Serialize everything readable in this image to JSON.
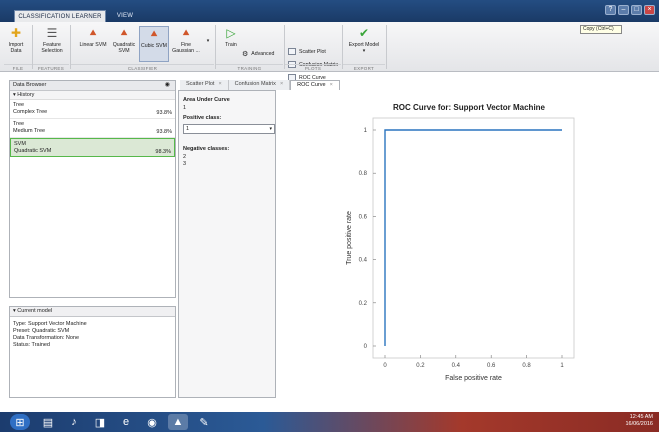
{
  "window": {
    "tabs": [
      "CLASSIFICATION LEARNER",
      "VIEW"
    ],
    "tooltip": "Copy (Ctrl+C)"
  },
  "ribbon": {
    "file": [
      {
        "label": "Import\nData"
      }
    ],
    "features": [
      {
        "label": "Feature\nSelection"
      }
    ],
    "classifier": [
      {
        "label": "Linear SVM"
      },
      {
        "label": "Quadratic\nSVM"
      },
      {
        "label": "Cubic SVM"
      },
      {
        "label": "Fine\nGaussian ..."
      }
    ],
    "training": {
      "train": "Train",
      "advanced": "Advanced"
    },
    "plots": [
      "Scatter Plot",
      "Confusion Matrix",
      "ROC Curve"
    ],
    "export": {
      "label": "Export Model"
    },
    "group_labels": [
      "FILE",
      "FEATURES",
      "CLASSIFIER",
      "TRAINING",
      "PLOTS",
      "EXPORT"
    ]
  },
  "data_browser": {
    "title": "Data Browser",
    "history_title": "History",
    "models": [
      {
        "type": "Tree",
        "name": "Complex Tree",
        "accuracy": "93.8%",
        "selected": false
      },
      {
        "type": "Tree",
        "name": "Medium Tree",
        "accuracy": "93.8%",
        "selected": false
      },
      {
        "type": "SVM",
        "name": "Quadratic SVM",
        "accuracy": "98.3%",
        "selected": true
      }
    ]
  },
  "current_model": {
    "title": "Current model",
    "lines": [
      "Type: Support Vector Machine",
      "Preset: Quadratic SVM",
      "Data Transformation: None",
      "Status: Trained"
    ]
  },
  "doc_tabs": [
    {
      "label": "Scatter Plot",
      "active": false
    },
    {
      "label": "Confusion Matrix",
      "active": false
    },
    {
      "label": "ROC Curve",
      "active": true
    }
  ],
  "roc_panel": {
    "auc_label": "Area Under Curve",
    "auc_value": "1",
    "positive_class_label": "Positive class:",
    "positive_class_value": "1",
    "negative_classes_label": "Negative classes:",
    "negative_classes": [
      "2",
      "3"
    ]
  },
  "chart_data": {
    "type": "line",
    "title": "ROC Curve for: Support Vector Machine",
    "xlabel": "False positive rate",
    "ylabel": "True positive rate",
    "xlim": [
      0,
      1
    ],
    "ylim": [
      0,
      1
    ],
    "xticks": [
      "0",
      "0.2",
      "0.4",
      "0.6",
      "0.8",
      "1"
    ],
    "yticks": [
      "0",
      "0.2",
      "0.4",
      "0.6",
      "0.8",
      "1"
    ],
    "series": [
      {
        "x": [
          0,
          0,
          1
        ],
        "y": [
          0,
          1,
          1
        ],
        "color": "#2a74bf"
      }
    ],
    "grid": false
  },
  "taskbar": {
    "time": "12:45 AM",
    "date": "16/06/2016"
  },
  "colors": {
    "accent": "#2a74bf",
    "selected_model": "#56b84a"
  }
}
